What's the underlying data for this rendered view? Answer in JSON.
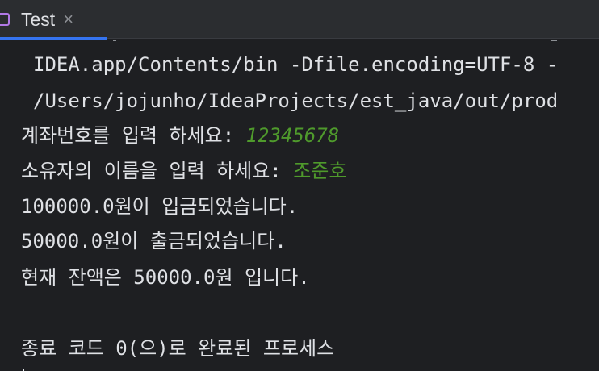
{
  "tab": {
    "title": "Test",
    "close_glyph": "×",
    "icon": "run-console-icon",
    "accent": "#3574f0",
    "icon_color": "#b179e6"
  },
  "console": {
    "cmd_line_1": "IDEA.app/Contents/bin -Dfile.encoding=UTF-8 -",
    "cmd_line_2": "/Users/jojunho/IdeaProjects/est_java/out/prod",
    "prompt_account": "계좌번호를 입력 하세요: ",
    "input_account": "12345678",
    "prompt_owner": "소유자의 이름을 입력 하세요: ",
    "input_owner": "조준호",
    "deposit_msg": "100000.0원이 입금되었습니다.",
    "withdraw_msg": "50000.0원이 출금되었습니다.",
    "balance_msg": "현재 잔액은 50000.0원 입니다.",
    "exit_msg": "종료 코드 0(으)로 완료된 프로세스",
    "input_color": "#4f9a2c",
    "text_color": "#dfe1e5",
    "background": "#1e1f22"
  }
}
